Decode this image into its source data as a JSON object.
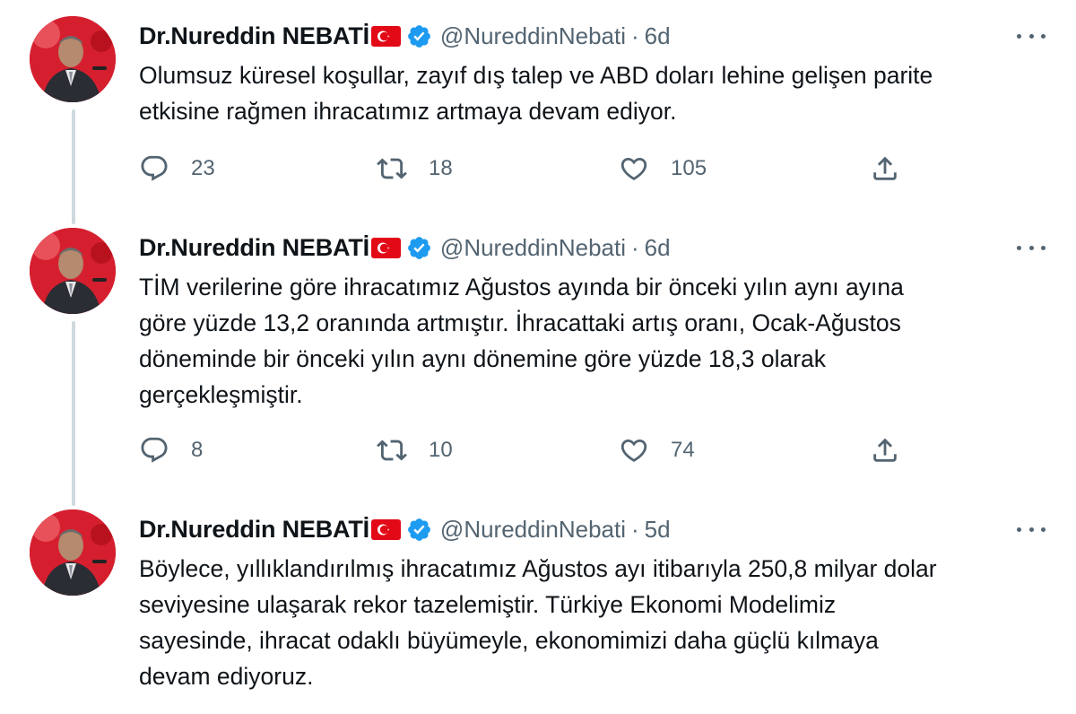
{
  "author": {
    "name": "Dr.Nureddin NEBATİ",
    "handle": "@NureddinNebati",
    "flag_icon": "turkey-flag-icon",
    "verified_icon": "verified-badge-icon",
    "verified_color": "#1d9bf0"
  },
  "colors": {
    "text": "#0f1419",
    "secondary": "#536471",
    "thread_line": "#cfd9de",
    "flag_red": "#e30a17"
  },
  "separator": "·",
  "tweets": [
    {
      "time": "6d",
      "lines": [
        "Olumsuz küresel koşullar, zayıf dış talep ve ABD doları lehine gelişen parite",
        "etkisine rağmen ihracatımız artmaya devam ediyor."
      ],
      "replies": "23",
      "retweets": "18",
      "likes": "105"
    },
    {
      "time": "6d",
      "lines": [
        "TİM verilerine göre ihracatımız Ağustos ayında bir önceki yılın aynı ayına",
        "göre yüzde 13,2 oranında artmıştır. İhracattaki artış oranı, Ocak-Ağustos",
        "döneminde bir önceki yılın aynı dönemine göre yüzde 18,3 olarak",
        "gerçekleşmiştir."
      ],
      "replies": "8",
      "retweets": "10",
      "likes": "74"
    },
    {
      "time": "5d",
      "lines": [
        "Böylece, yıllıklandırılmış ihracatımız Ağustos ayı itibarıyla 250,8 milyar dolar",
        "seviyesine ulaşarak rekor tazelemiştir. Türkiye Ekonomi Modelimiz",
        "sayesinde, ihracat odaklı büyümeyle, ekonomimizi daha güçlü kılmaya",
        "devam ediyoruz."
      ]
    }
  ]
}
